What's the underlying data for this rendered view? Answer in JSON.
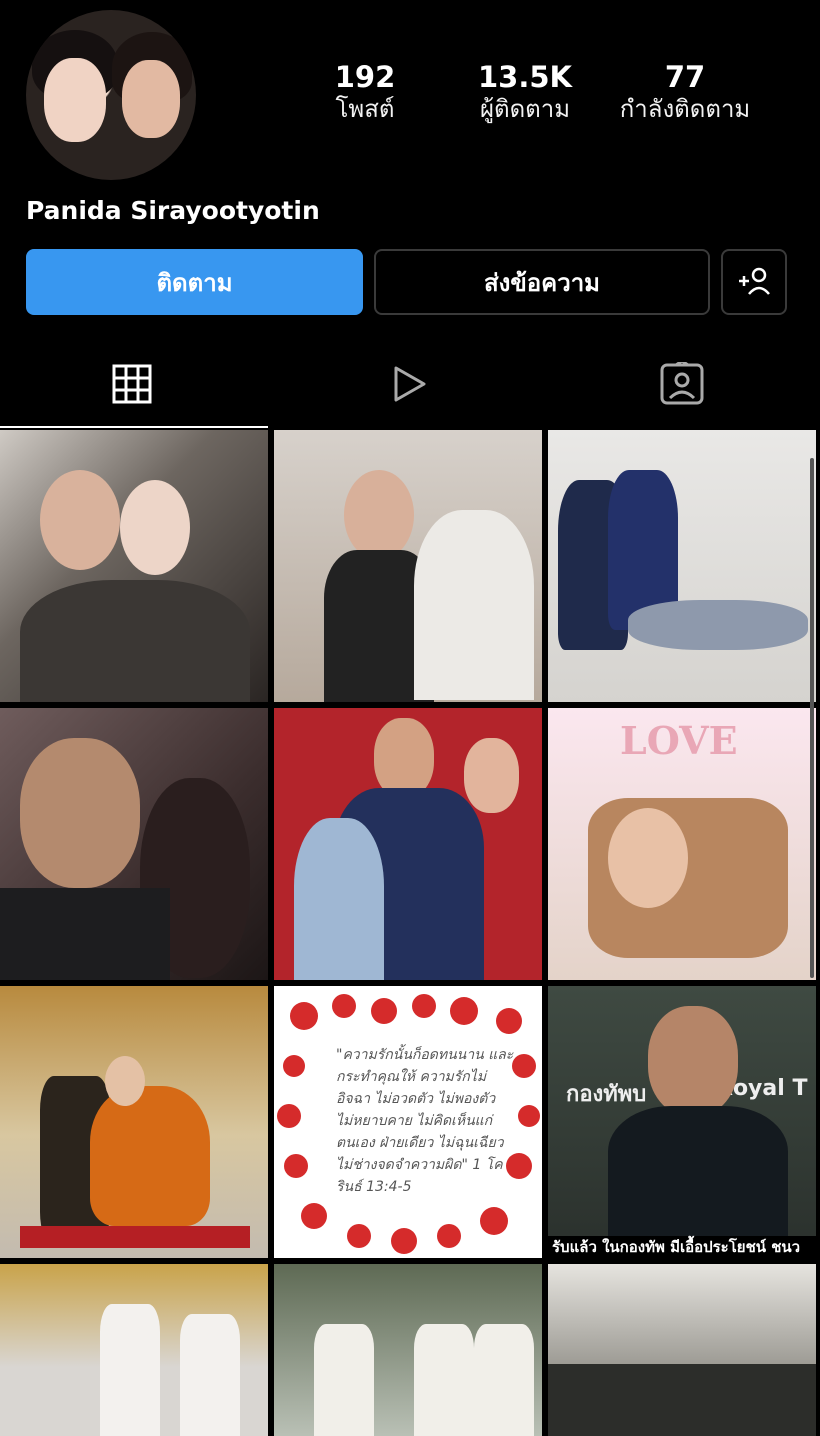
{
  "profile": {
    "username": "Panida Sirayootyotin",
    "posts_count": "192",
    "posts_label": "โพสต์",
    "followers_count": "13.5K",
    "followers_label": "ผู้ติดตาม",
    "following_count": "77",
    "following_label": "กำลังติดตาม"
  },
  "actions": {
    "follow_label": "ติดตาม",
    "message_label": "ส่งข้อความ",
    "add_person_icon": "add-person-icon"
  },
  "tabs": [
    {
      "icon": "grid-icon",
      "active": true
    },
    {
      "icon": "reels-play-icon",
      "active": false
    },
    {
      "icon": "tagged-person-icon",
      "active": false
    }
  ],
  "posts": {
    "post6_text": "LOVE",
    "post8_quote": "\"ความรักนั้นก็อดทนนาน และกระทำคุณให้ ความรักไม่อิจฉา ไม่อวดตัว ไม่พองตัว ไม่หยาบคาย ไม่คิดเห็นแก่ตนเอง ฝ่ายเดียว ไม่ฉุนเฉียว ไม่ช่างจดจำความผิด\" 1 โครินธ์ 13:4-5",
    "post9_sign_left": "กองทัพบ",
    "post9_sign_right": "Royal T",
    "post9_caption": "รับแล้ว ในกองทัพ มีเอื้อประโยชน์ ชนว"
  },
  "colors": {
    "background": "#000000",
    "follow_button": "#3897f0",
    "border": "#3a3a3a"
  }
}
